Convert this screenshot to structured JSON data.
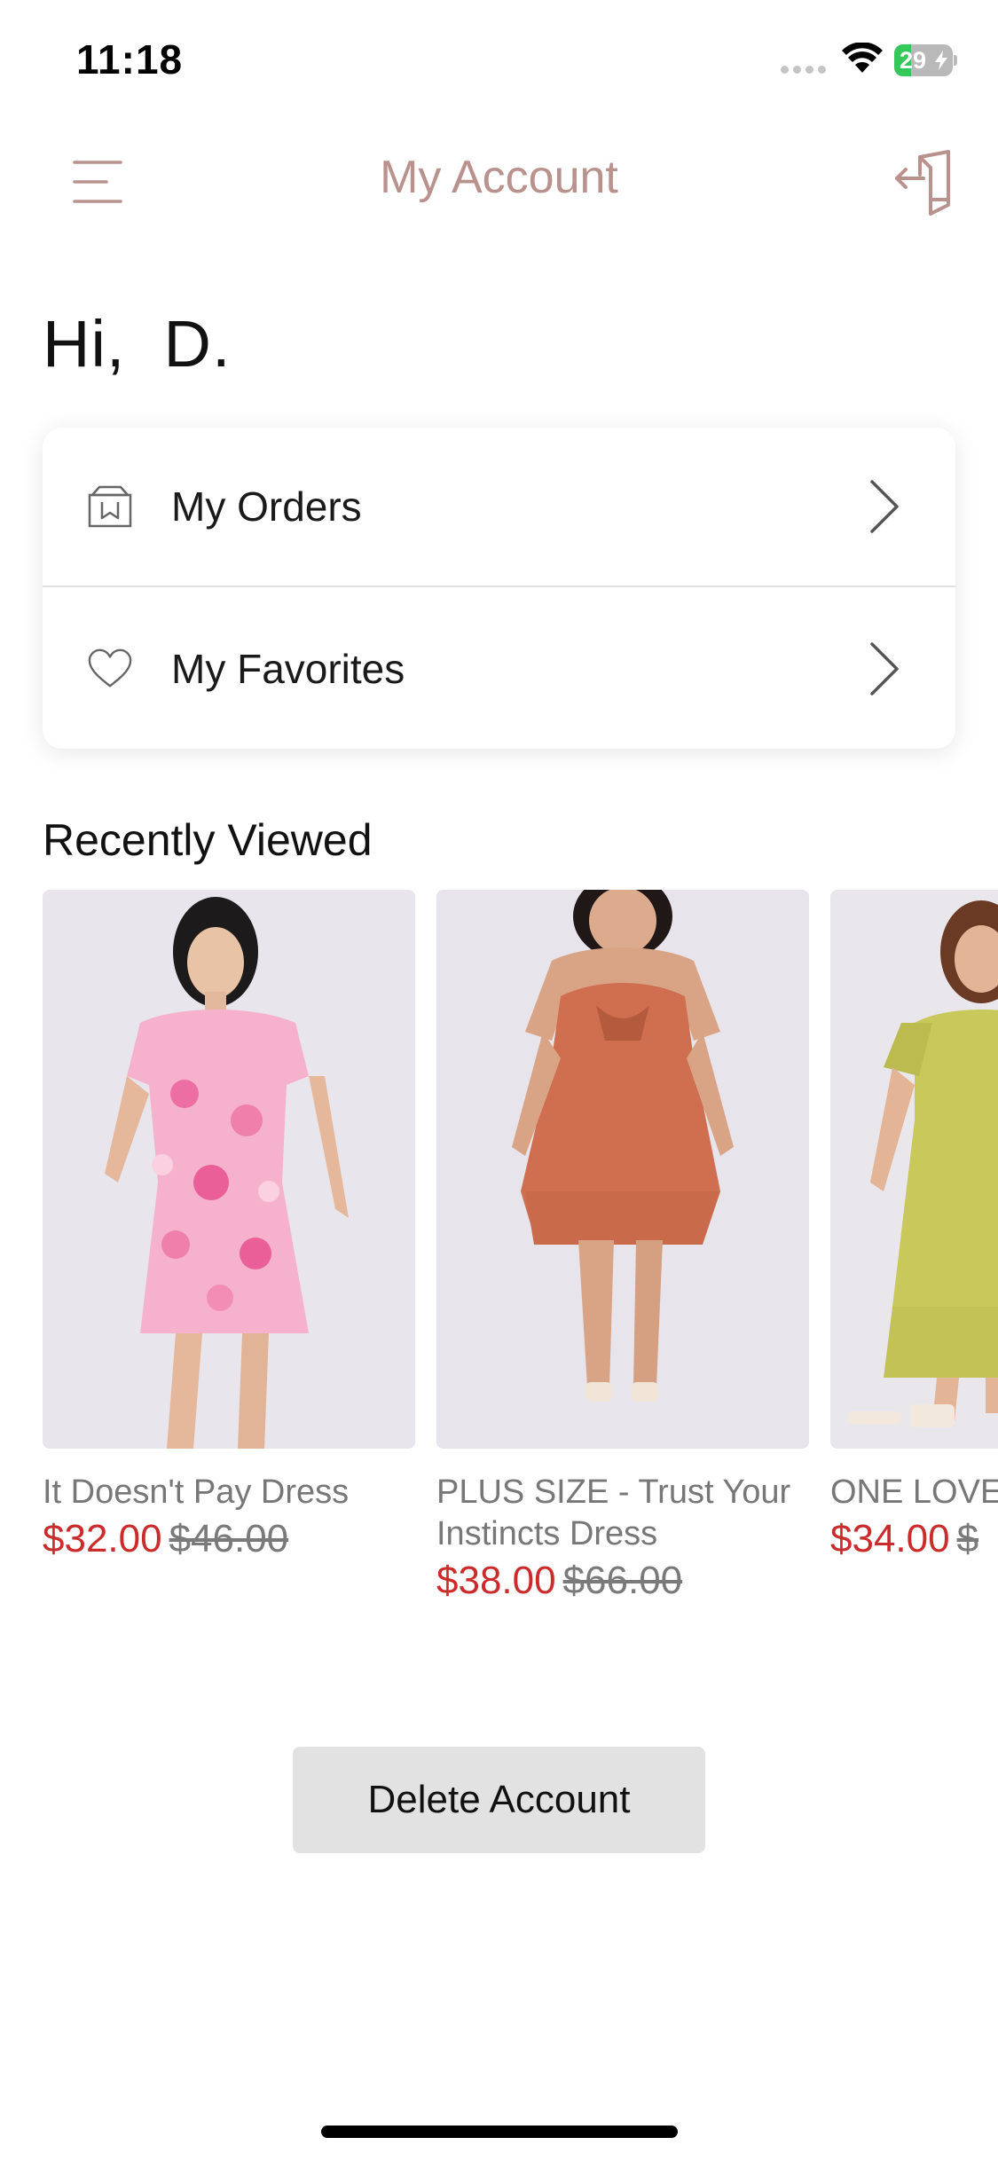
{
  "status_bar": {
    "time": "11:18",
    "battery_level": "29",
    "battery_fraction": 0.29,
    "battery_color": "#34c759",
    "icons": [
      "signal-dots-icon",
      "wifi-icon",
      "battery-charging-icon"
    ]
  },
  "nav": {
    "title": "My Account",
    "menu_icon": "hamburger-menu-icon",
    "logout_icon": "logout-door-icon",
    "accent_color": "#b9918d"
  },
  "greeting": "Hi,  D.",
  "account_menu": [
    {
      "label": "My Orders",
      "icon": "orders-box-icon"
    },
    {
      "label": "My Favorites",
      "icon": "heart-icon"
    }
  ],
  "recently_viewed": {
    "title": "Recently Viewed",
    "products": [
      {
        "name": "It Doesn't Pay Dress",
        "sale_price": "$32.00",
        "original_price": "$46.00",
        "image": "pink-floral-mini-dress"
      },
      {
        "name": "PLUS SIZE - Trust Your Instincts Dress",
        "sale_price": "$38.00",
        "original_price": "$66.00",
        "image": "rust-orange-midi-dress"
      },
      {
        "name": "ONE LOVE June Dress",
        "sale_price": "$34.00",
        "original_price": "$",
        "image": "chartreuse-tiered-dress"
      }
    ]
  },
  "delete_button": "Delete Account",
  "colors": {
    "sale_price": "#cc2b2b",
    "original_price": "#7a7a7a",
    "delete_button_bg": "#e2e2e2"
  }
}
